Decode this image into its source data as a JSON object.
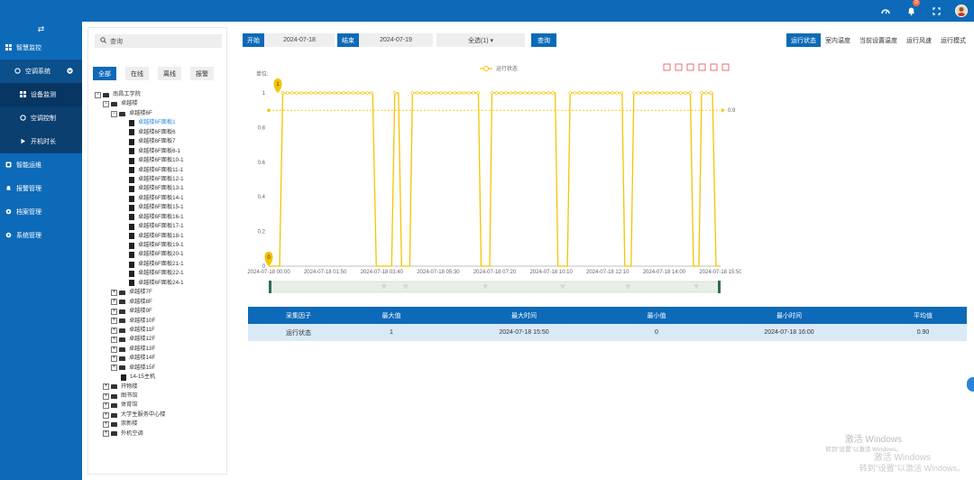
{
  "topbar": {
    "notifications_badge": "0",
    "icons": [
      "dashboard-icon",
      "bell-icon",
      "fullscreen-icon",
      "avatar"
    ]
  },
  "sidebar": {
    "toggle_glyph": "⇄",
    "items": [
      {
        "label": "智慧监控",
        "icon": "grid-icon"
      },
      {
        "label": "空调系统",
        "icon": "circle-icon"
      },
      {
        "label": "设备监测",
        "icon": "grid-icon"
      },
      {
        "label": "空调控制",
        "icon": "circle-icon"
      },
      {
        "label": "开机时长",
        "icon": "play-icon"
      },
      {
        "label": "智能运维",
        "icon": "tools-icon"
      },
      {
        "label": "报警管理",
        "icon": "bell-icon"
      },
      {
        "label": "档案管理",
        "icon": "gear-icon"
      },
      {
        "label": "系统管理",
        "icon": "gear-icon"
      }
    ]
  },
  "left": {
    "search_placeholder": "查询",
    "filters": [
      "全部",
      "在线",
      "离线",
      "报警"
    ],
    "tree": [
      {
        "label": "南昌工学院",
        "level": 0,
        "box": "−",
        "type": "folder"
      },
      {
        "label": "卓越楼",
        "level": 1,
        "box": "−",
        "type": "folder"
      },
      {
        "label": "卓越楼6F",
        "level": 2,
        "box": "−",
        "type": "folder"
      },
      {
        "label": "卓越楼6F面板1",
        "level": 3,
        "type": "doc",
        "selected": true
      },
      {
        "label": "卓越楼6F面板6",
        "level": 3,
        "type": "doc"
      },
      {
        "label": "卓越楼6F面板7",
        "level": 3,
        "type": "doc"
      },
      {
        "label": "卓越楼6F面板6-1",
        "level": 3,
        "type": "doc"
      },
      {
        "label": "卓越楼6F面板10-1",
        "level": 3,
        "type": "doc"
      },
      {
        "label": "卓越楼6F面板11-1",
        "level": 3,
        "type": "doc"
      },
      {
        "label": "卓越楼6F面板12-1",
        "level": 3,
        "type": "doc"
      },
      {
        "label": "卓越楼6F面板13-1",
        "level": 3,
        "type": "doc"
      },
      {
        "label": "卓越楼6F面板14-1",
        "level": 3,
        "type": "doc"
      },
      {
        "label": "卓越楼6F面板15-1",
        "level": 3,
        "type": "doc"
      },
      {
        "label": "卓越楼6F面板16-1",
        "level": 3,
        "type": "doc"
      },
      {
        "label": "卓越楼6F面板17-1",
        "level": 3,
        "type": "doc"
      },
      {
        "label": "卓越楼6F面板18-1",
        "level": 3,
        "type": "doc"
      },
      {
        "label": "卓越楼6F面板19-1",
        "level": 3,
        "type": "doc"
      },
      {
        "label": "卓越楼6F面板20-1",
        "level": 3,
        "type": "doc"
      },
      {
        "label": "卓越楼6F面板21-1",
        "level": 3,
        "type": "doc"
      },
      {
        "label": "卓越楼6F面板22-1",
        "level": 3,
        "type": "doc"
      },
      {
        "label": "卓越楼6F面板24-1",
        "level": 3,
        "type": "doc"
      },
      {
        "label": "卓越楼7F",
        "level": 2,
        "box": "+",
        "type": "folder"
      },
      {
        "label": "卓越楼8F",
        "level": 2,
        "box": "+",
        "type": "folder"
      },
      {
        "label": "卓越楼9F",
        "level": 2,
        "box": "+",
        "type": "folder"
      },
      {
        "label": "卓越楼10F",
        "level": 2,
        "box": "+",
        "type": "folder"
      },
      {
        "label": "卓越楼11F",
        "level": 2,
        "box": "+",
        "type": "folder"
      },
      {
        "label": "卓越楼12F",
        "level": 2,
        "box": "+",
        "type": "folder"
      },
      {
        "label": "卓越楼13F",
        "level": 2,
        "box": "+",
        "type": "folder"
      },
      {
        "label": "卓越楼14F",
        "level": 2,
        "box": "+",
        "type": "folder"
      },
      {
        "label": "卓越楼15F",
        "level": 2,
        "box": "+",
        "type": "folder"
      },
      {
        "label": "14-15主机",
        "level": 2,
        "type": "doc"
      },
      {
        "label": "开物楼",
        "level": 1,
        "box": "+",
        "type": "folder"
      },
      {
        "label": "图书馆",
        "level": 1,
        "box": "+",
        "type": "folder"
      },
      {
        "label": "体育馆",
        "level": 1,
        "box": "+",
        "type": "folder"
      },
      {
        "label": "大学生服务中心楼",
        "level": 1,
        "box": "+",
        "type": "folder"
      },
      {
        "label": "崇新楼",
        "level": 1,
        "box": "+",
        "type": "folder"
      },
      {
        "label": "外机空调",
        "level": 1,
        "box": "+",
        "type": "folder"
      }
    ]
  },
  "query": {
    "start_label": "开始",
    "start_value": "2024-07-18",
    "end_label": "结束",
    "end_value": "2024-07-19",
    "select_value": "全选(1) ▾",
    "query_button": "查询"
  },
  "tabs": [
    "运行状态",
    "室内温度",
    "当前设置温度",
    "运行风速",
    "运行模式"
  ],
  "chart_data": {
    "type": "line",
    "unit_label": "单位:",
    "legend": "运行状态",
    "series_color": "#f5c400",
    "ylim": [
      0,
      1
    ],
    "yticks": [
      "0",
      "0.2",
      "0.4",
      "0.6",
      "0.8",
      "1"
    ],
    "xticks": [
      "2024-07-18 00:00",
      "2024-07-18 01:50",
      "2024-07-18 03:40",
      "2024-07-18 05:30",
      "2024-07-18 07:20",
      "2024-07-18 10:10",
      "2024-07-18 12:10",
      "2024-07-18 14:00",
      "2024-07-18 15:50"
    ],
    "max_marker": "1",
    "min_marker": "0",
    "avg_label": "0.9",
    "average": 0.9,
    "segments": [
      {
        "x_start": 0.0,
        "x_end": 0.024,
        "value": 0
      },
      {
        "x_start": 0.031,
        "x_end": 0.23,
        "value": 1
      },
      {
        "x_start": 0.238,
        "x_end": 0.272,
        "value": 0
      },
      {
        "x_start": 0.279,
        "x_end": 0.287,
        "value": 1
      },
      {
        "x_start": 0.294,
        "x_end": 0.312,
        "value": 0
      },
      {
        "x_start": 0.318,
        "x_end": 0.464,
        "value": 1
      },
      {
        "x_start": 0.47,
        "x_end": 0.489,
        "value": 0
      },
      {
        "x_start": 0.494,
        "x_end": 0.634,
        "value": 1
      },
      {
        "x_start": 0.64,
        "x_end": 0.661,
        "value": 0
      },
      {
        "x_start": 0.667,
        "x_end": 0.782,
        "value": 1
      },
      {
        "x_start": 0.788,
        "x_end": 0.802,
        "value": 0
      },
      {
        "x_start": 0.808,
        "x_end": 0.933,
        "value": 1
      },
      {
        "x_start": 0.94,
        "x_end": 0.952,
        "value": 0
      },
      {
        "x_start": 0.958,
        "x_end": 0.982,
        "value": 1
      },
      {
        "x_start": 0.99,
        "x_end": 1.0,
        "value": 0
      }
    ],
    "toolbox_icons": [
      "zoom-icon",
      "zoom-reset-icon",
      "line-icon",
      "bar-icon",
      "refresh-icon",
      "download-icon"
    ]
  },
  "table": {
    "headers": [
      "采集因子",
      "最大值",
      "最大时间",
      "最小值",
      "最小时间",
      "平均值"
    ],
    "row": [
      "运行状态",
      "1",
      "2024-07-18 15:50",
      "0",
      "2024-07-18 16:00",
      "0.90"
    ]
  },
  "watermark": {
    "line1": "激活 Windows",
    "line2": "转到\"设置\"以激活 Windows。",
    "line3": "激活 Windows",
    "line4": "转到\"设置\"以激活 Windows。"
  }
}
